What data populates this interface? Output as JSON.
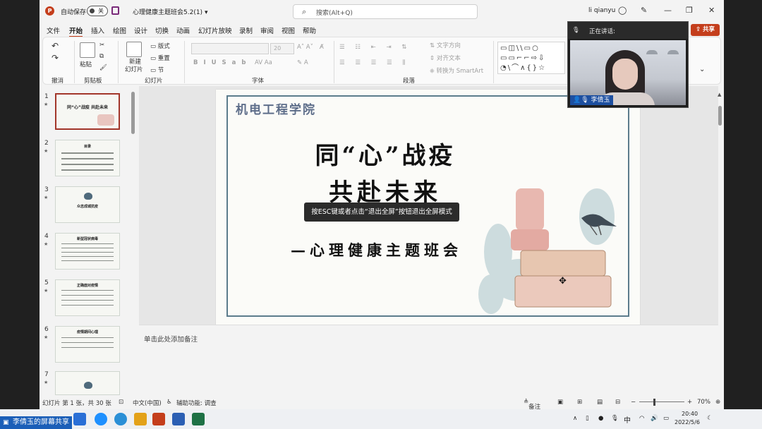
{
  "titlebar": {
    "app_logo": "P",
    "autosave_label": "自动保存",
    "autosave_state": "关",
    "doc_title": "心理健康主题班会5.2(1)",
    "doc_title_chevron": "▾",
    "search_placeholder": "搜索(Alt+Q)",
    "user_name": "li qianyu"
  },
  "menu": {
    "tabs": [
      "文件",
      "开始",
      "插入",
      "绘图",
      "设计",
      "切换",
      "动画",
      "幻灯片放映",
      "录制",
      "审阅",
      "视图",
      "帮助"
    ],
    "active_tab": "开始"
  },
  "ribbon": {
    "group_undo": "撤消",
    "group_clipboard": "剪贴板",
    "paste_label": "粘贴",
    "group_slides": "幻灯片",
    "new_slide_label": "新建",
    "new_slide_label2": "幻灯片",
    "layout_label": "版式",
    "reset_label": "重置",
    "section_label": "节",
    "group_font": "字体",
    "font_size": "20",
    "group_paragraph": "段落",
    "text_direction": "文字方向",
    "align_text": "对齐文本",
    "convert_smartart": "转换为 SmartArt"
  },
  "thumbnails": [
    {
      "num": "1",
      "text": "同“心”战疫 共赴未来",
      "selected": true
    },
    {
      "num": "2",
      "text": "目录",
      "selected": false
    },
    {
      "num": "3",
      "text": "众志成城抗疫",
      "selected": false
    },
    {
      "num": "4",
      "text": "新型冠状病毒",
      "selected": false
    },
    {
      "num": "5",
      "text": "正确面对疫情",
      "selected": false
    },
    {
      "num": "6",
      "text": "疫情期间心理",
      "selected": false
    },
    {
      "num": "7",
      "text": "",
      "selected": false
    }
  ],
  "slide": {
    "school": "机电工程学院",
    "title_line1": "同“心”战疫",
    "title_line2": "共赴未来",
    "subtitle": "—心理健康主题班会"
  },
  "tooltip": "按ESC键或者点击“退出全屏”按钮退出全屏模式",
  "notes_placeholder": "单击此处添加备注",
  "statusbar": {
    "slide_info": "幻灯片 第 1 张，共 30 张",
    "language": "中文(中国)",
    "accessibility": "辅助功能: 调查",
    "notes_button": "备注",
    "zoom": "70%"
  },
  "video": {
    "speaking_label": "正在讲话:",
    "speaker_name": "李倩玉",
    "share_button": "共享"
  },
  "taskbar": {
    "share_label": "李倩玉的屏幕共享",
    "ime": "中",
    "time": "20:40",
    "date": "2022/5/6"
  }
}
